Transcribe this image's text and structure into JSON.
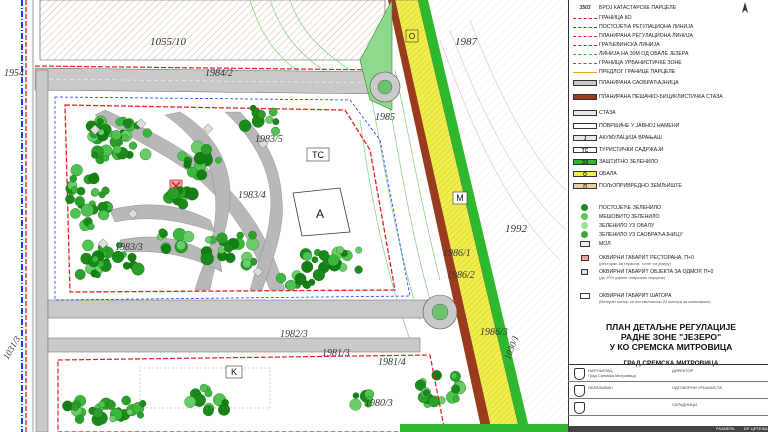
{
  "map": {
    "parcels": {
      "p1055_10": "1055/10",
      "p1987": "1987",
      "p1954": "1954",
      "p1984_2": "1984/2",
      "p1985": "1985",
      "p1983_5": "1983/5",
      "p1983_4": "1983/4",
      "p1983_3": "1983/3",
      "p1986_1": "1986/1",
      "p1986_2": "1986/2",
      "p1992": "1992",
      "p1986_3": "1986/3",
      "p1982_3": "1982/3",
      "p1981_3": "1981/3",
      "p1981_4": "1981/4",
      "p1980_3": "1980/3",
      "p1030_1": "1030/1",
      "p1031_3": "1031/3"
    },
    "zones": {
      "tc": "TC",
      "a": "A",
      "m": "M",
      "k": "K",
      "o": "O"
    }
  },
  "legend": {
    "items": [
      {
        "label": "БРОЈ КАТАСТАРСКЕ ПАРЦЕЛЕ",
        "code": "3503"
      },
      {
        "label": "ГРАНИЦА КО"
      },
      {
        "label": "ПОСТОЈЕЋА РЕГУЛАЦИОНА ЛИНИЈА"
      },
      {
        "label": "ПЛАНИРАНА РЕГУЛАЦИОНА ЛИНИЈА"
      },
      {
        "label": "ГРАЂЕВИНСКА ЛИНИЈА"
      },
      {
        "label": "ЛИНИЈА НА 30М ОД ОБАЛЕ ЈЕЗЕРА"
      },
      {
        "label": "ГРАНИЦА УРБАНИСТИЧКЕ ЗОНЕ"
      },
      {
        "label": "ПРЕДЛОГ ГРАНИЦЕ ПАРЦЕЛЕ"
      },
      {
        "label": "ПЛАНИРАНА САОБРАЋАЈНИЦА"
      },
      {
        "label": "ПЛАНИРАНА ПЕШАЧКО-БИЦИКЛИСТИЧКА СТАЗА"
      },
      {
        "label": "СТАЗА"
      },
      {
        "label": "ПОВРШИНЕ У ЈАВНОЈ НАМЕНИ"
      },
      {
        "label": "АКУМУЛАЦИЈА ВРАЊАШ",
        "code": "Ј"
      },
      {
        "label": "ТУРИСТИЧКИ САДРЖАЈИ",
        "code": "ТС"
      },
      {
        "label": "ЗАШТИТНО ЗЕЛЕНИЛО",
        "code": "ЗЗ"
      },
      {
        "label": "ОБАЛА",
        "code": "О"
      },
      {
        "label": "ПОЉОПРИВРЕДНО ЗЕМЉИШТЕ",
        "code": "П"
      },
      {
        "label": "ПОСТОЈЕЋЕ ЗЕЛЕНИЛО"
      },
      {
        "label": "МЕШОВИТО ЗЕЛЕНИЛО"
      },
      {
        "label": "ЗЕЛЕНИЛО УЗ ОБАЛУ"
      },
      {
        "label": "ЗЕЛЕНИЛО УЗ САОБРАЋАЈНИЦУ"
      },
      {
        "label": "МОЛ"
      },
      {
        "label": "ОКВИРНИ ГАБАРИТ РЕСТОРАНА, П+0",
        "note": "(ресторан са терасом, толет на језеру)"
      },
      {
        "label": "ОКВИРНИ ГАБАРИТ ОБЈЕКТА ЗА ОДМОР, П+0",
        "note": "(до 10% укупне површине парцеле)"
      },
      {
        "label": "ОКВИРНИ ГАБАРИТ ШАТОРА",
        "note": "(Ветеран шатор са постављањем 22 шатора за камповање)"
      }
    ]
  },
  "title": {
    "line1": "ПЛАН ДЕТАЉНЕ РЕГУЛАЦИЈЕ",
    "line2": "РАДНЕ ЗОНЕ \"ЈЕЗЕРО\"",
    "line3": "У КО СРЕМСКА МИТРОВИЦА",
    "city": "ГРАД СРЕМСКА МИТРОВИЦА"
  },
  "info": {
    "rows": [
      {
        "c1": "НАРУЧИЛАЦ",
        "c1b": "Град Сремска Митровица",
        "c2": "ДИРЕКТОР"
      },
      {
        "c1": "ОБРАЂИВАЧ",
        "c1b": "",
        "c2": "ОДГОВОРНИ УРБАНИСТА"
      },
      {
        "c1": "",
        "c1b": "",
        "c2": "САРАДНИЦИ"
      }
    ],
    "scale_label": "РАЗМЕРА",
    "sheet_label": "БР. ЦРТЕЖА"
  }
}
